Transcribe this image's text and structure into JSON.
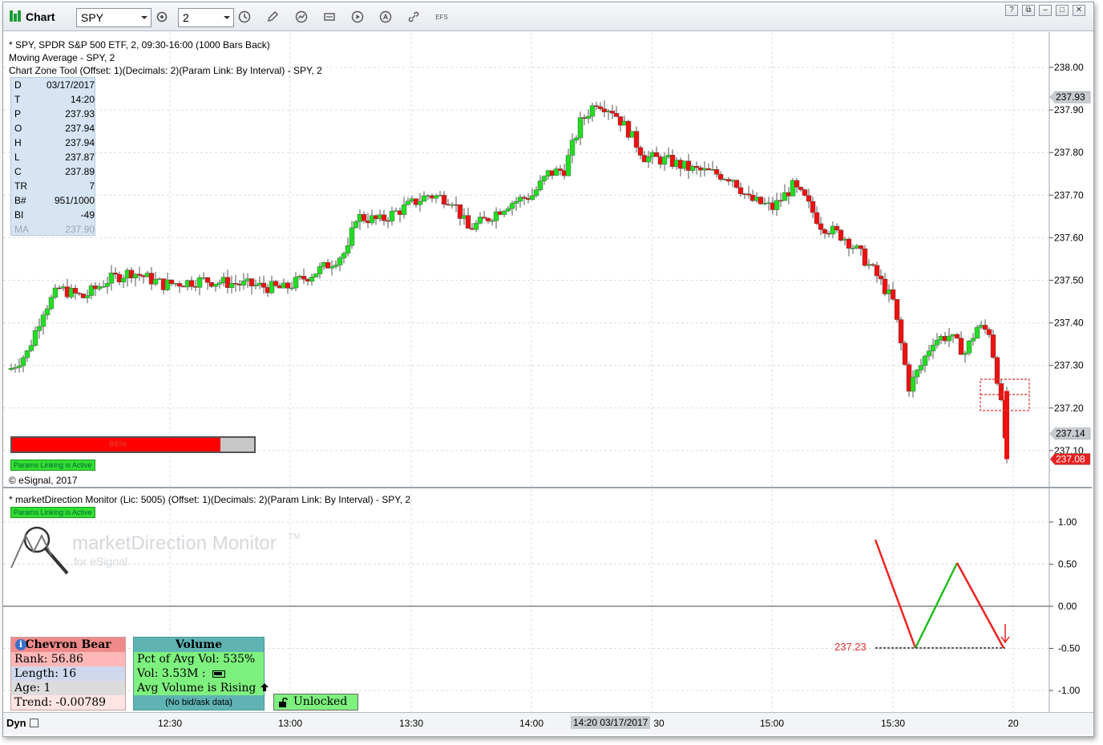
{
  "toolbar": {
    "app_title": "Chart",
    "symbol": "SPY",
    "interval": "2",
    "efs_label": "EFS",
    "window_buttons": [
      "?",
      "⧉",
      "–",
      "□",
      "✕"
    ]
  },
  "price_pane": {
    "header_line1": "* SPY, SPDR S&P 500 ETF, 2, 09:30-16:00 (1000 Bars Back)",
    "header_line2": "Moving Average - SPY, 2",
    "header_line3": "Chart Zone Tool (Offset: 1)(Decimals: 2)(Param Link: By Interval) - SPY, 2",
    "data_window": [
      {
        "k": "D",
        "v": "03/17/2017"
      },
      {
        "k": "T",
        "v": "14:20"
      },
      {
        "k": "P",
        "v": "237.93"
      },
      {
        "k": "O",
        "v": "237.94"
      },
      {
        "k": "H",
        "v": "237.94"
      },
      {
        "k": "L",
        "v": "237.87"
      },
      {
        "k": "C",
        "v": "237.89"
      },
      {
        "k": "TR",
        "v": "7"
      },
      {
        "k": "B#",
        "v": "951/1000"
      },
      {
        "k": "BI",
        "v": "-49"
      },
      {
        "k": "MA",
        "v": "237.90"
      }
    ],
    "progress_percent": 86,
    "progress_label": "86%",
    "params_badge": "Params Linking is Active",
    "copyright": "© eSignal, 2017",
    "y_ticks": [
      "238.00",
      "237.90",
      "237.80",
      "237.70",
      "237.60",
      "237.50",
      "237.40",
      "237.30",
      "237.20",
      "237.10"
    ],
    "y_tick_values": [
      238.0,
      237.9,
      237.8,
      237.7,
      237.6,
      237.5,
      237.4,
      237.3,
      237.2,
      237.1
    ],
    "price_flags": [
      {
        "label": "237.93",
        "value": 237.93,
        "color": "#c8ccd2",
        "text_color": "#000000"
      },
      {
        "label": "237.14",
        "value": 237.14,
        "color": "#c8ccd2",
        "text_color": "#000000"
      },
      {
        "label": "237.08",
        "value": 237.08,
        "color": "#e82020",
        "text_color": "#ffffff"
      }
    ],
    "up_color": "#22dd22",
    "down_color": "#ee1111"
  },
  "md_pane": {
    "header": "* marketDirection Monitor (Lic: 5005) (Offset: 1)(Decimals: 2)(Param Link: By Interval) - SPY, 2",
    "params_badge": "Params Linking is Active",
    "logo_text": "marketDirection Monitor",
    "logo_tm": "TM",
    "logo_sub": "for eSignal",
    "y_ticks": [
      "1.00",
      "0.50",
      "0.00",
      "-0.50",
      "-1.00"
    ],
    "y_tick_values": [
      1.0,
      0.5,
      0.0,
      -0.5,
      -1.0
    ],
    "level_label": "237.23",
    "bear_panel": {
      "title": "Chevron Bear",
      "rank": "Rank: 56.86",
      "length": "Length: 16",
      "age": "Age: 1",
      "trend": "Trend: -0.00789"
    },
    "volume_panel": {
      "title": "Volume",
      "pct": "Pct of Avg Vol: 535%",
      "vol": "Vol: 3.53M :",
      "avg": "Avg Volume is Rising",
      "bidask": "(No bid/ask data)"
    },
    "unlocked_label": "Unlocked"
  },
  "time_axis": {
    "dyn_label": "Dyn",
    "labels": [
      "12:30",
      "13:00",
      "13:30",
      "14:00",
      "30",
      "15:00",
      "15:30",
      "20"
    ],
    "cursor_label": "14:20 03/17/2017"
  }
}
